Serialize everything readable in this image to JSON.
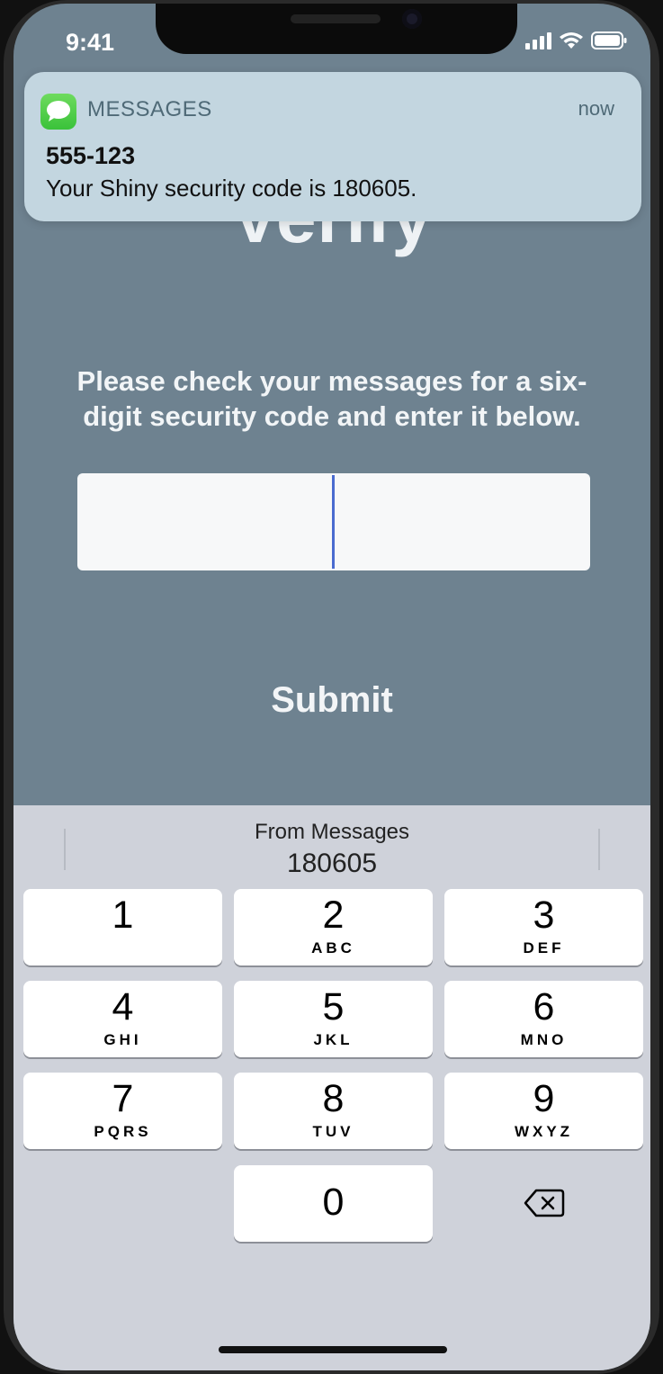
{
  "status_bar": {
    "time": "9:41"
  },
  "notification": {
    "app": "MESSAGES",
    "time": "now",
    "sender": "555-123",
    "body": "Your Shiny security code is 180605."
  },
  "page": {
    "title": "Verify",
    "instructions": "Please check your messages for a six-digit security code and enter it below.",
    "code_input_value": "",
    "submit_label": "Submit"
  },
  "keyboard": {
    "suggestion_label": "From Messages",
    "suggestion_code": "180605",
    "keys": [
      {
        "num": "1",
        "letters": ""
      },
      {
        "num": "2",
        "letters": "ABC"
      },
      {
        "num": "3",
        "letters": "DEF"
      },
      {
        "num": "4",
        "letters": "GHI"
      },
      {
        "num": "5",
        "letters": "JKL"
      },
      {
        "num": "6",
        "letters": "MNO"
      },
      {
        "num": "7",
        "letters": "PQRS"
      },
      {
        "num": "8",
        "letters": "TUV"
      },
      {
        "num": "9",
        "letters": "WXYZ"
      },
      {
        "num": "0",
        "letters": ""
      }
    ],
    "delete_icon": "backspace-icon"
  }
}
